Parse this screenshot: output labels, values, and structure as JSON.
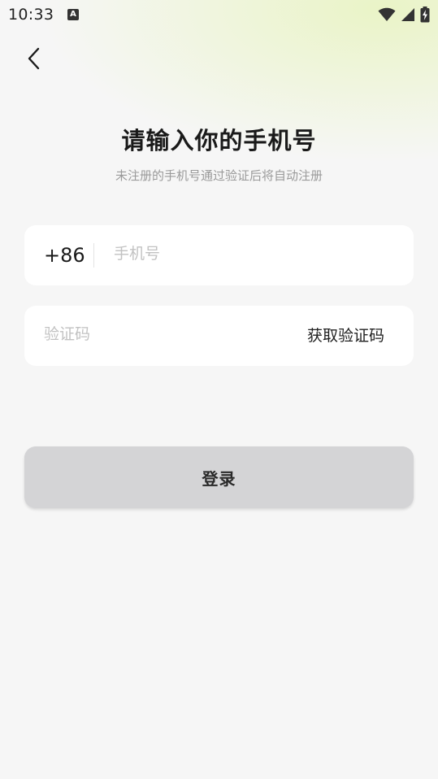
{
  "status_bar": {
    "time": "10:33",
    "notification_icon": "font-a-icon",
    "icons": [
      "wifi-icon",
      "signal-icon",
      "battery-charging-icon"
    ]
  },
  "header": {
    "back_icon": "chevron-left-icon"
  },
  "main": {
    "title": "请输入你的手机号",
    "subtitle": "未注册的手机号通过验证后将自动注册",
    "phone": {
      "country_code": "+86",
      "value": "",
      "placeholder": "手机号"
    },
    "code": {
      "value": "",
      "placeholder": "验证码",
      "get_code_label": "获取验证码"
    },
    "login_label": "登录"
  },
  "colors": {
    "background": "#f6f6f6",
    "accent_glow": "#e9f4c4",
    "button_disabled": "#d4d4d6",
    "placeholder": "#c2c2c2"
  }
}
